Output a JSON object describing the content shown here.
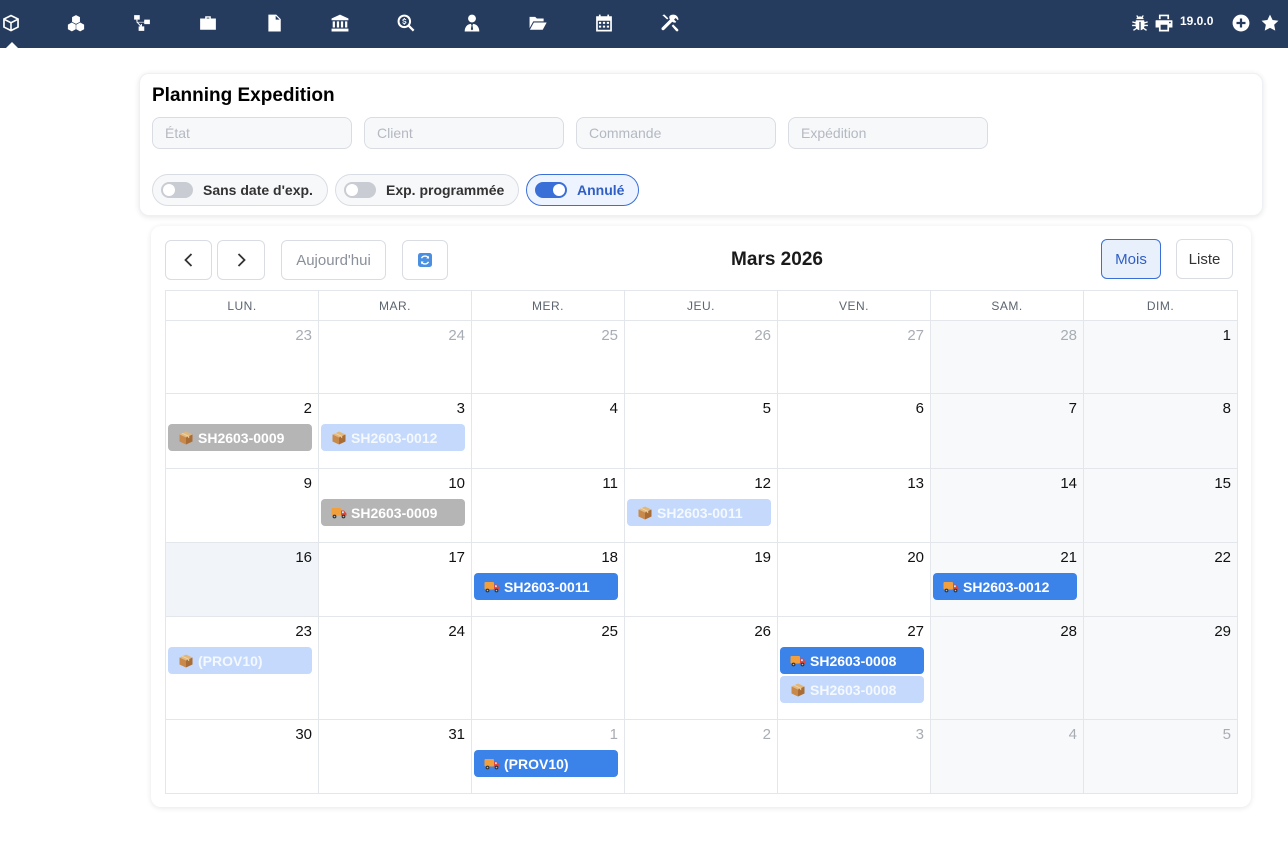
{
  "topbar": {
    "icons": [
      "cube-icon",
      "cubes-icon",
      "sitemap-icon",
      "briefcase-icon",
      "invoice-icon",
      "bank-icon",
      "search-dollar-icon",
      "user-tie-icon",
      "folder-open-icon",
      "calendar-icon",
      "tools-icon",
      "bug-icon",
      "print-icon",
      "plus-circle-icon",
      "star-icon"
    ],
    "version": "19.0.0"
  },
  "filters": {
    "title": "Planning Expedition",
    "inputs": [
      {
        "placeholder": "État",
        "value": ""
      },
      {
        "placeholder": "Client",
        "value": ""
      },
      {
        "placeholder": "Commande",
        "value": ""
      },
      {
        "placeholder": "Expédition",
        "value": ""
      }
    ],
    "toggles": [
      {
        "label": "Sans date d'exp.",
        "on": false
      },
      {
        "label": "Exp. programmée",
        "on": false
      },
      {
        "label": "Annulé",
        "on": true
      }
    ]
  },
  "calendar": {
    "today_label": "Aujourd'hui",
    "title": "Mars 2026",
    "view_month": "Mois",
    "view_list": "Liste",
    "weekdays": [
      "LUN.",
      "MAR.",
      "MER.",
      "JEU.",
      "VEN.",
      "SAM.",
      "DIM."
    ],
    "weeks": [
      [
        {
          "d": "23",
          "o": true,
          "ev": []
        },
        {
          "d": "24",
          "o": true,
          "ev": []
        },
        {
          "d": "25",
          "o": true,
          "ev": []
        },
        {
          "d": "26",
          "o": true,
          "ev": []
        },
        {
          "d": "27",
          "o": true,
          "ev": []
        },
        {
          "d": "28",
          "o": true,
          "ev": []
        },
        {
          "d": "1",
          "o": false,
          "ev": []
        }
      ],
      [
        {
          "d": "2",
          "o": false,
          "ev": [
            {
              "label": "SH2603-0009",
              "icon": "package",
              "style": "gray"
            }
          ]
        },
        {
          "d": "3",
          "o": false,
          "ev": [
            {
              "label": "SH2603-0012",
              "icon": "package",
              "style": "light"
            }
          ]
        },
        {
          "d": "4",
          "o": false,
          "ev": []
        },
        {
          "d": "5",
          "o": false,
          "ev": []
        },
        {
          "d": "6",
          "o": false,
          "ev": []
        },
        {
          "d": "7",
          "o": false,
          "ev": []
        },
        {
          "d": "8",
          "o": false,
          "ev": []
        }
      ],
      [
        {
          "d": "9",
          "o": false,
          "ev": []
        },
        {
          "d": "10",
          "o": false,
          "ev": [
            {
              "label": "SH2603-0009",
              "icon": "truck",
              "style": "gray"
            }
          ]
        },
        {
          "d": "11",
          "o": false,
          "ev": []
        },
        {
          "d": "12",
          "o": false,
          "ev": [
            {
              "label": "SH2603-0011",
              "icon": "package",
              "style": "light"
            }
          ]
        },
        {
          "d": "13",
          "o": false,
          "ev": []
        },
        {
          "d": "14",
          "o": false,
          "ev": []
        },
        {
          "d": "15",
          "o": false,
          "ev": []
        }
      ],
      [
        {
          "d": "16",
          "o": false,
          "today": true,
          "ev": []
        },
        {
          "d": "17",
          "o": false,
          "ev": []
        },
        {
          "d": "18",
          "o": false,
          "ev": [
            {
              "label": "SH2603-0011",
              "icon": "truck",
              "style": "blue"
            }
          ]
        },
        {
          "d": "19",
          "o": false,
          "ev": []
        },
        {
          "d": "20",
          "o": false,
          "ev": []
        },
        {
          "d": "21",
          "o": false,
          "ev": [
            {
              "label": "SH2603-0012",
              "icon": "truck",
              "style": "blue"
            }
          ]
        },
        {
          "d": "22",
          "o": false,
          "ev": []
        }
      ],
      [
        {
          "d": "23",
          "o": false,
          "ev": [
            {
              "label": "(PROV10)",
              "icon": "package",
              "style": "light"
            }
          ]
        },
        {
          "d": "24",
          "o": false,
          "ev": []
        },
        {
          "d": "25",
          "o": false,
          "ev": []
        },
        {
          "d": "26",
          "o": false,
          "ev": []
        },
        {
          "d": "27",
          "o": false,
          "ev": [
            {
              "label": "SH2603-0008",
              "icon": "truck",
              "style": "blue"
            },
            {
              "label": "SH2603-0008",
              "icon": "package",
              "style": "light"
            }
          ]
        },
        {
          "d": "28",
          "o": false,
          "ev": []
        },
        {
          "d": "29",
          "o": false,
          "ev": []
        }
      ],
      [
        {
          "d": "30",
          "o": false,
          "ev": []
        },
        {
          "d": "31",
          "o": false,
          "ev": []
        },
        {
          "d": "1",
          "o": true,
          "ev": [
            {
              "label": "(PROV10)",
              "icon": "truck",
              "style": "blue"
            }
          ]
        },
        {
          "d": "2",
          "o": true,
          "ev": []
        },
        {
          "d": "3",
          "o": true,
          "ev": []
        },
        {
          "d": "4",
          "o": true,
          "ev": []
        },
        {
          "d": "5",
          "o": true,
          "ev": []
        }
      ]
    ]
  }
}
